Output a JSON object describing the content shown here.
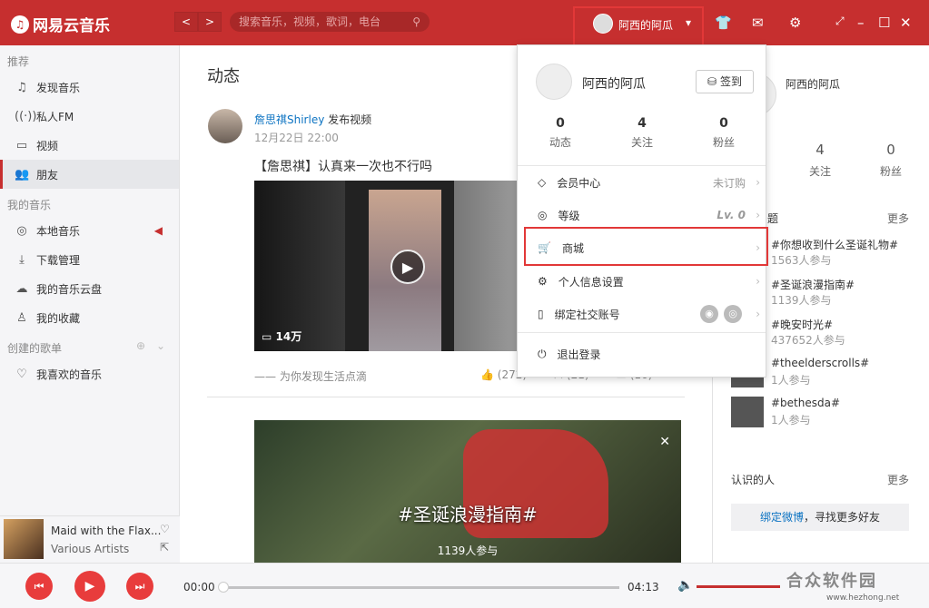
{
  "header": {
    "app_name": "网易云音乐",
    "back": "<",
    "forward": ">",
    "search_placeholder": "搜索音乐，视频，歌词，电台",
    "username": "阿西的阿瓜"
  },
  "sidebar": {
    "sec_recommend": "推荐",
    "items": [
      {
        "label": "发现音乐"
      },
      {
        "label": "私人FM"
      },
      {
        "label": "视频"
      },
      {
        "label": "朋友"
      }
    ],
    "sec_my": "我的音乐",
    "my": [
      {
        "label": "本地音乐"
      },
      {
        "label": "下载管理"
      },
      {
        "label": "我的音乐云盘"
      },
      {
        "label": "我的收藏"
      }
    ],
    "sec_created": "创建的歌单",
    "created": [
      {
        "label": "我喜欢的音乐"
      }
    ]
  },
  "now_playing": {
    "title": "Maid with the Flax...",
    "artist": "Various Artists"
  },
  "main": {
    "title": "动态",
    "post": {
      "user": "詹思祺Shirley",
      "action": "发布视频",
      "time": "12月22日 22:00",
      "text": "【詹思祺】认真来一次也不行吗",
      "plays": "14万",
      "discover": "—— 为你发现生活点滴",
      "likes": "(272)",
      "shares": "(21)",
      "comments": "(16)"
    },
    "banner": {
      "title": "#圣诞浪漫指南#",
      "sub": "1139人参与"
    }
  },
  "right": {
    "name": "阿西的阿瓜",
    "stats": [
      {
        "n": "4",
        "l": "关注"
      },
      {
        "n": "0",
        "l": "粉丝"
      }
    ],
    "topics_h": "题",
    "more": "更多",
    "topics": [
      {
        "name": "#你想收到什么圣诞礼物#",
        "count": "1563人参与"
      },
      {
        "name": "#圣诞浪漫指南#",
        "count": "1139人参与"
      },
      {
        "name": "#晚安时光#",
        "count": "437652人参与"
      },
      {
        "name": "#theelderscrolls#",
        "count": "1人参与"
      },
      {
        "name": "#bethesda#",
        "count": "1人参与"
      }
    ],
    "know": "认识的人",
    "more2": "更多",
    "bind_weibo": "绑定微博",
    "bind_rest": "，寻找更多好友"
  },
  "dropdown": {
    "name": "阿西的阿瓜",
    "signin": "签到",
    "stats": [
      {
        "n": "0",
        "l": "动态"
      },
      {
        "n": "4",
        "l": "关注"
      },
      {
        "n": "0",
        "l": "粉丝"
      }
    ],
    "items": [
      {
        "label": "会员中心",
        "right": "未订购"
      },
      {
        "label": "等级",
        "right": "Lv. 0"
      },
      {
        "label": "商城",
        "right": ""
      },
      {
        "label": "个人信息设置",
        "right": ""
      },
      {
        "label": "绑定社交账号",
        "right": ""
      },
      {
        "label": "退出登录",
        "right": ""
      }
    ]
  },
  "player": {
    "current": "00:00",
    "total": "04:13"
  },
  "watermark": {
    "text": "合众软件园",
    "url": "www.hezhong.net"
  },
  "colors": {
    "brand": "#c62f2f",
    "link": "#0c73c2"
  }
}
